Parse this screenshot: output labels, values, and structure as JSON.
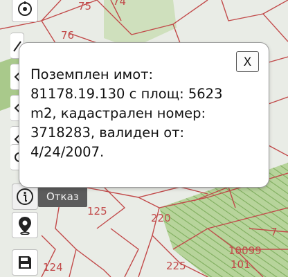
{
  "map": {
    "parcel_labels": [
      "75",
      "74",
      "76",
      "125",
      "220",
      "7",
      "10099",
      "124",
      "225",
      "101"
    ]
  },
  "popup": {
    "text": "Поземплен имот: 81178.19.130 с площ: 5623 m2, кадастрален номер: 3718283, валиден от: 4/24/2007.",
    "close_label": "X"
  },
  "toolbar": {
    "tooltip": "Отказ"
  },
  "colors": {
    "parcel_line": "#c24a4a",
    "green_zone": "#a9c98b",
    "green_hatch": "#7fae5e",
    "map_background": "#e9ece6",
    "tooltip_bg": "#5c5c5c"
  }
}
